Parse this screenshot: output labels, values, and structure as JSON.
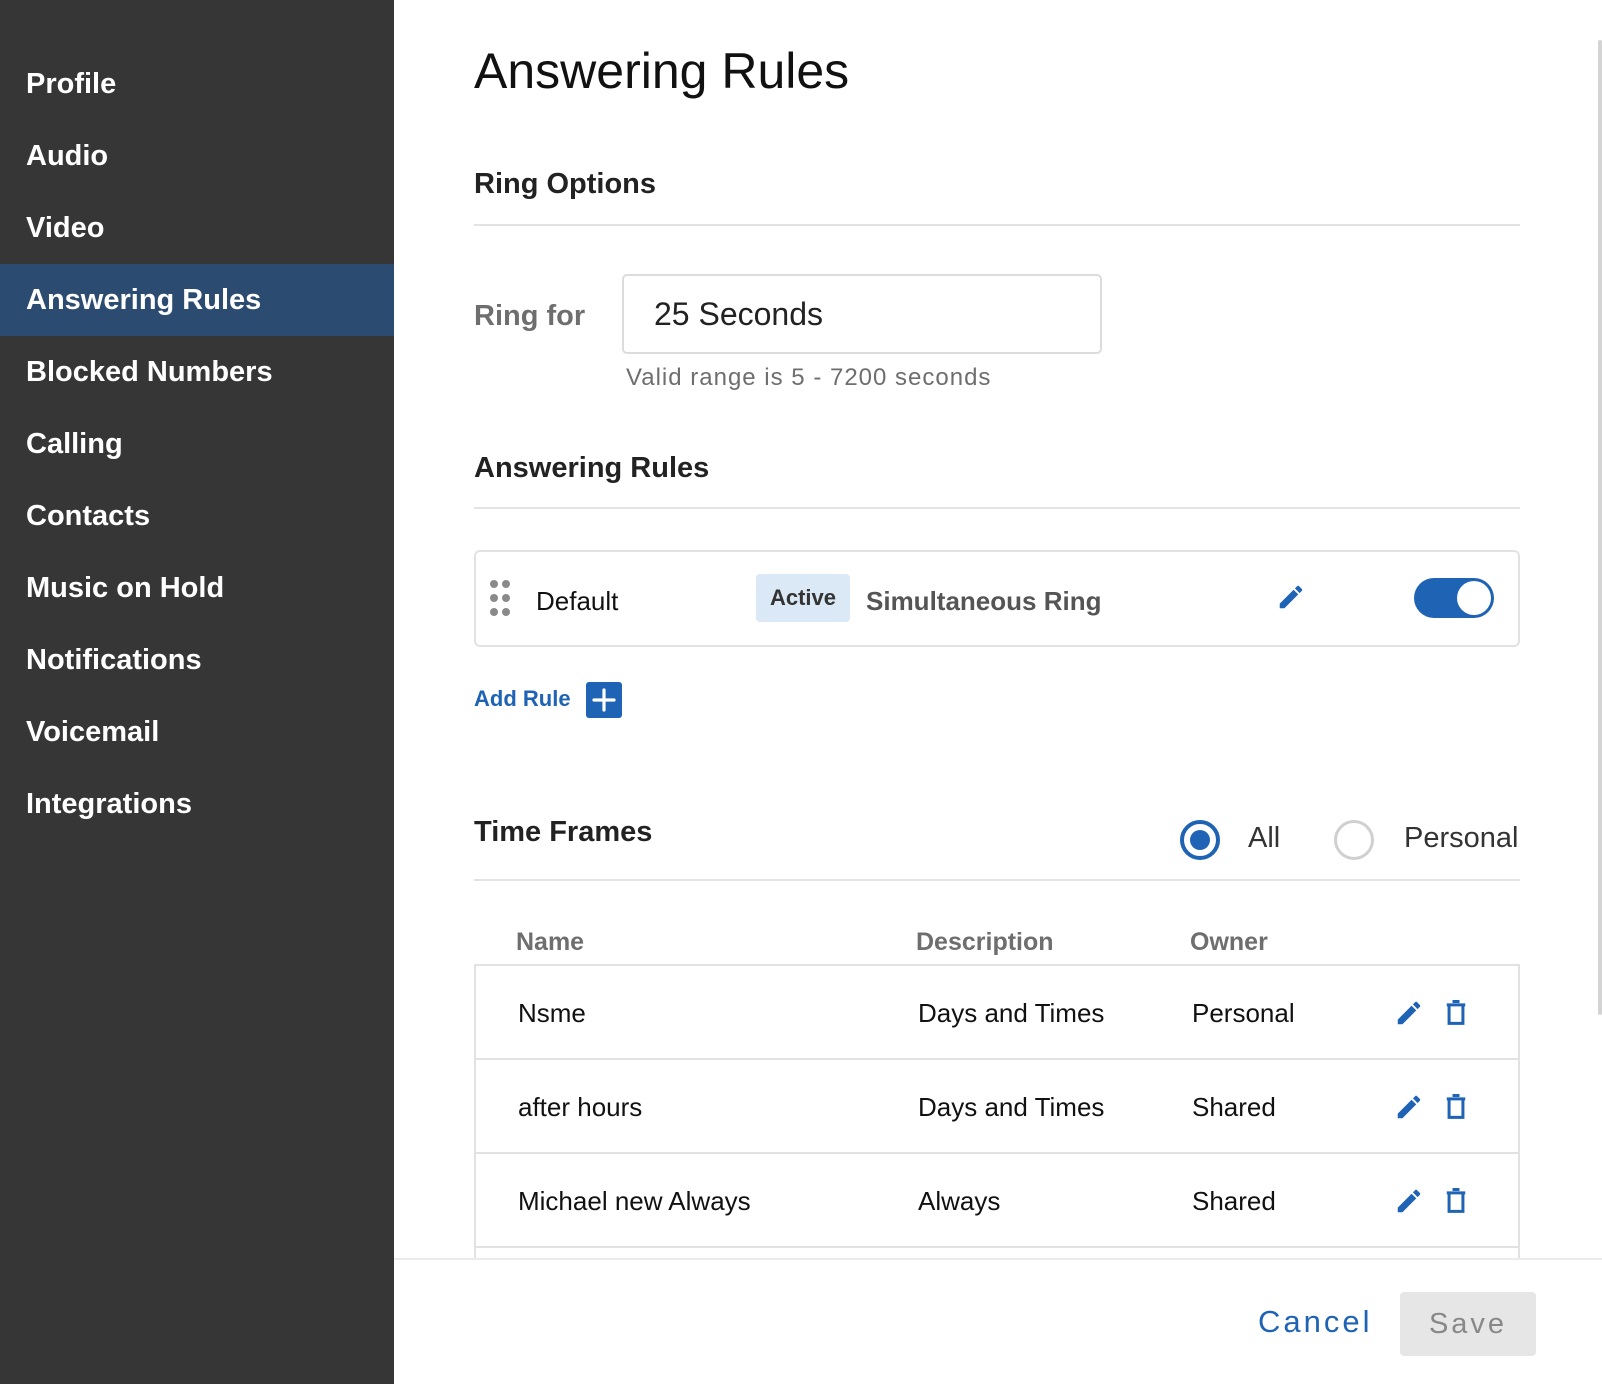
{
  "sidebar": {
    "items": [
      {
        "label": "Profile"
      },
      {
        "label": "Audio"
      },
      {
        "label": "Video"
      },
      {
        "label": "Answering Rules",
        "active": true
      },
      {
        "label": "Blocked Numbers"
      },
      {
        "label": "Calling"
      },
      {
        "label": "Contacts"
      },
      {
        "label": "Music on Hold"
      },
      {
        "label": "Notifications"
      },
      {
        "label": "Voicemail"
      },
      {
        "label": "Integrations"
      }
    ]
  },
  "page": {
    "title": "Answering Rules"
  },
  "ring_options": {
    "title": "Ring Options",
    "ring_for_label": "Ring for",
    "ring_for_value": "25 Seconds",
    "hint": "Valid range is 5 - 7200 seconds"
  },
  "answering_rules": {
    "title": "Answering Rules",
    "rules": [
      {
        "name": "Default",
        "status": "Active",
        "type": "Simultaneous Ring",
        "enabled": true,
        "icons": [
          "drag-handle-icon",
          "pencil-icon"
        ]
      }
    ],
    "add_rule_label": "Add Rule",
    "add_icon": "plus-icon"
  },
  "time_frames": {
    "title": "Time Frames",
    "filter_options": [
      {
        "label": "All",
        "selected": true
      },
      {
        "label": "Personal",
        "selected": false
      }
    ],
    "columns": [
      "Name",
      "Description",
      "Owner"
    ],
    "rows": [
      {
        "name": "Nsme",
        "description": "Days and Times",
        "owner": "Personal"
      },
      {
        "name": "after hours",
        "description": "Days and Times",
        "owner": "Shared"
      },
      {
        "name": "Michael new Always",
        "description": "Always",
        "owner": "Shared"
      }
    ],
    "row_icons": [
      "pencil-icon",
      "trash-icon"
    ]
  },
  "footer": {
    "cancel_label": "Cancel",
    "save_label": "Save"
  },
  "colors": {
    "sidebar_bg": "#363636",
    "sidebar_active": "#2c4b70",
    "accent": "#1f63b5",
    "badge_bg": "#dbe8f6"
  }
}
